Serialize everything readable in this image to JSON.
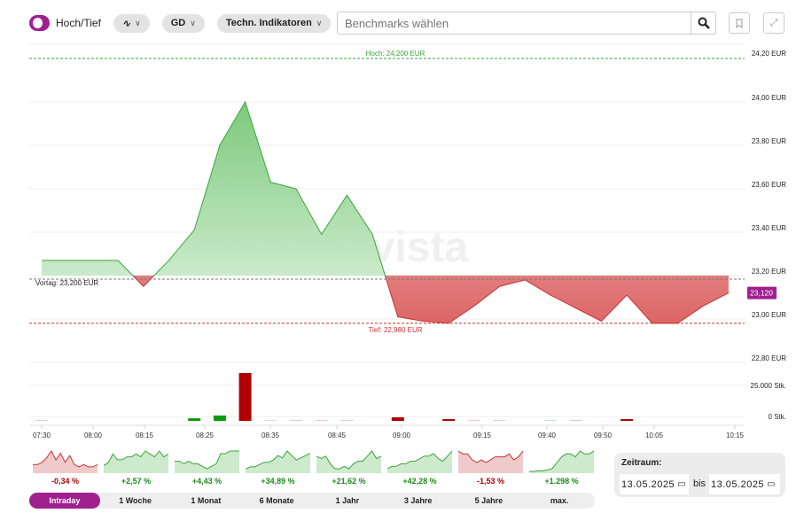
{
  "toolbar": {
    "toggle_label": "Hoch/Tief",
    "chart_type_icon": "line-chart-icon",
    "gd_label": "GD",
    "indicators_label": "Techn. Indikatoren",
    "search_placeholder": "Benchmarks wählen"
  },
  "colors": {
    "accent": "#a0208f",
    "up": "#3aa53a",
    "down": "#c83232",
    "bar_up": "#0a9a0a",
    "bar_down": "#b00000"
  },
  "watermark": "onvista",
  "chart_data": {
    "type": "area",
    "y_ticks": [
      "24,20 EUR",
      "24,00 EUR",
      "23,80 EUR",
      "23,60 EUR",
      "23,40 EUR",
      "23,20 EUR",
      "23,00 EUR",
      "22,80 EUR"
    ],
    "y_tick_values": [
      24.2,
      24.0,
      23.8,
      23.6,
      23.4,
      23.2,
      23.0,
      22.8
    ],
    "ylim": [
      22.8,
      24.2
    ],
    "x_ticks": [
      "07:30",
      "08:00",
      "08:15",
      "08:25",
      "08:35",
      "08:45",
      "09:00",
      "09:15",
      "09:40",
      "09:50",
      "10:05",
      "10:15"
    ],
    "prices": [
      23.27,
      23.27,
      23.27,
      23.27,
      23.15,
      23.27,
      23.41,
      23.8,
      24.0,
      23.63,
      23.6,
      23.39,
      23.57,
      23.39,
      23.01,
      22.99,
      22.98,
      23.06,
      23.15,
      23.18,
      23.11,
      23.05,
      22.99,
      23.11,
      22.98,
      22.98,
      23.06,
      23.12
    ],
    "previous_close": 23.2,
    "previous_close_label": "Vortag: 23,200 EUR",
    "high": 24.2,
    "high_label": "Hoch: 24,200 EUR",
    "low": 22.98,
    "low_label": "Tief: 22,980 EUR",
    "last_label": "23,120",
    "volume_ticks": [
      "25.000 Stk.",
      "0 Stk."
    ],
    "volumes": [
      300,
      0,
      0,
      0,
      0,
      0,
      2100,
      4300,
      38600,
      200,
      200,
      300,
      300,
      0,
      2900,
      0,
      1400,
      300,
      300,
      0,
      200,
      200,
      0,
      1400,
      0,
      0,
      0,
      0
    ],
    "volume_dir": [
      "down",
      "",
      "",
      "",
      "",
      "",
      "up",
      "up",
      "down",
      "up",
      "down",
      "down",
      "down",
      "",
      "down",
      "",
      "down",
      "down",
      "down",
      "",
      "up",
      "down",
      "",
      "down",
      "",
      "",
      "",
      ""
    ]
  },
  "sparklines": [
    {
      "pct": "-0,34 %",
      "dir": "down",
      "values": [
        3,
        3,
        4,
        6,
        9,
        5,
        8,
        4,
        7,
        3,
        2,
        3,
        2,
        2,
        3
      ]
    },
    {
      "pct": "+2,57 %",
      "dir": "up",
      "values": [
        2,
        3,
        6,
        4,
        4,
        5,
        5,
        6,
        5,
        7,
        6,
        5,
        7,
        5,
        6
      ]
    },
    {
      "pct": "+4,43 %",
      "dir": "up",
      "values": [
        4,
        4,
        3,
        4,
        3,
        3,
        2,
        1,
        2,
        3,
        7,
        7,
        8,
        8,
        8
      ]
    },
    {
      "pct": "+34,89 %",
      "dir": "up",
      "values": [
        1,
        2,
        2,
        3,
        4,
        4,
        5,
        7,
        6,
        9,
        7,
        5,
        6,
        7,
        8
      ]
    },
    {
      "pct": "+21,62 %",
      "dir": "up",
      "values": [
        6,
        5,
        6,
        3,
        1,
        1,
        2,
        1,
        3,
        4,
        4,
        6,
        8,
        5,
        6
      ]
    },
    {
      "pct": "+42,28 %",
      "dir": "up",
      "values": [
        1,
        2,
        2,
        3,
        3,
        4,
        4,
        5,
        6,
        6,
        7,
        5,
        4,
        6,
        8
      ]
    },
    {
      "pct": "-1,53 %",
      "dir": "down",
      "values": [
        7,
        6,
        6,
        4,
        3,
        4,
        3,
        4,
        5,
        5,
        5,
        6,
        4,
        5,
        7
      ]
    },
    {
      "pct": "+1.298 %",
      "dir": "up",
      "values": [
        0,
        0,
        0.2,
        0.2,
        0.5,
        1,
        3,
        5,
        6,
        6,
        5,
        7,
        6,
        6,
        7
      ]
    }
  ],
  "ranges": [
    "Intraday",
    "1 Woche",
    "1 Monat",
    "6 Monate",
    "1 Jahr",
    "3 Jahre",
    "5 Jahre",
    "max."
  ],
  "zeitraum": {
    "label": "Zeitraum:",
    "from": "13.05.2025",
    "bis": "bis",
    "to": "13.05.2025"
  }
}
